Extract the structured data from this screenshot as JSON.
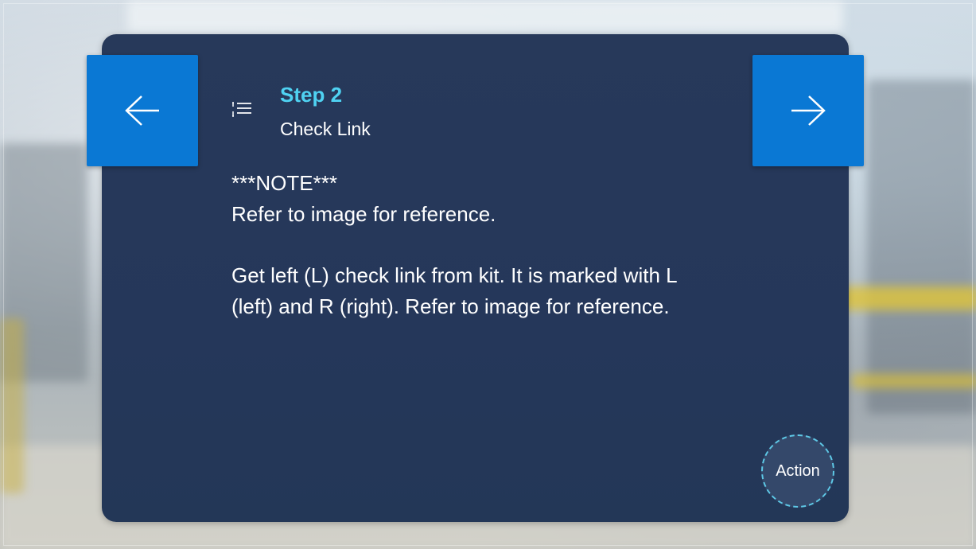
{
  "step": {
    "title": "Step 2",
    "subtitle": "Check Link"
  },
  "instruction": {
    "note": "***NOTE***",
    "line1": "Refer to image for reference.",
    "line2": "Get left (L) check link from kit. It is marked with L (left) and R (right). Refer to image for reference."
  },
  "controls": {
    "action_label": "Action"
  },
  "colors": {
    "accent_blue": "#0a78d4",
    "title_cyan": "#4fd2f2",
    "card_bg": "#25375a"
  }
}
